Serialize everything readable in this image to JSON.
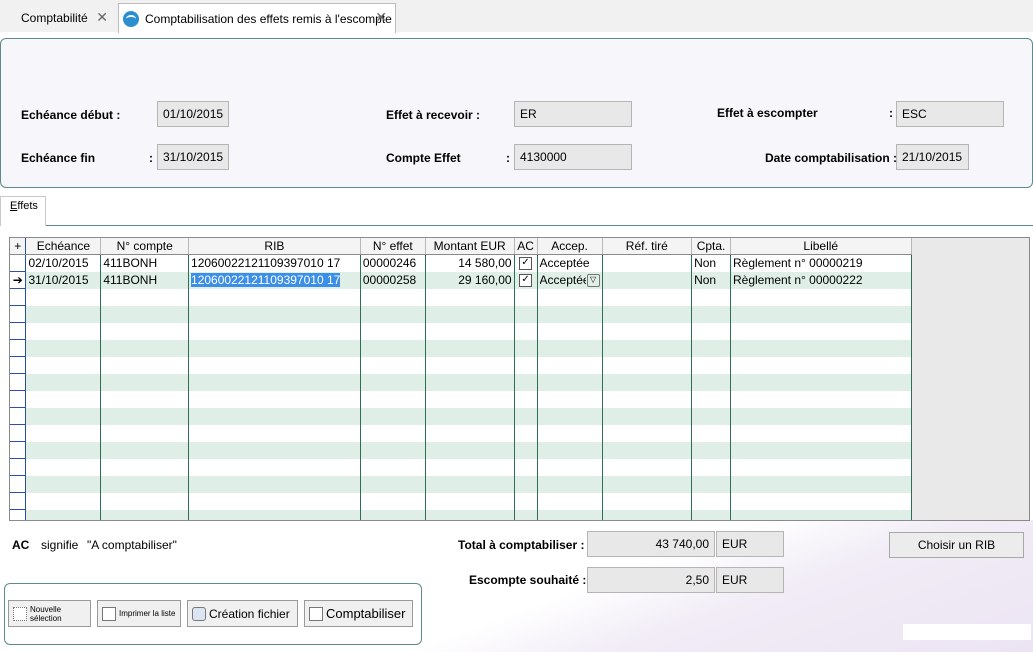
{
  "tabs": [
    {
      "label": "Comptabilité",
      "active": false
    },
    {
      "label": "Comptabilisation des effets remis à l'escompte",
      "active": true
    }
  ],
  "header": {
    "echeance_debut_label": "Echéance début :",
    "echeance_debut_value": "01/10/2015",
    "echeance_fin_label": "Echéance fin",
    "echeance_fin_value": "31/10/2015",
    "effet_recevoir_label": "Effet à recevoir :",
    "effet_recevoir_value": "ER",
    "compte_effet_label": "Compte Effet",
    "compte_effet_value": "4130000",
    "effet_escompter_label": "Effet à escompter",
    "effet_escompter_value": "ESC",
    "date_compta_label": "Date comptabilisation :",
    "date_compta_value": "21/10/2015",
    "colon": ":"
  },
  "subtab": {
    "label_first": "E",
    "label_rest": "ffets"
  },
  "grid": {
    "add_symbol": "+",
    "columns": [
      "Echéance",
      "N° compte",
      "RIB",
      "N° effet",
      "Montant EUR",
      "AC",
      "Accep.",
      "Réf. tiré",
      "Cpta.",
      "Libellé"
    ],
    "rows": [
      {
        "echeance": "02/10/2015",
        "compte": "411BONH",
        "rib": "12060022121109397010 17",
        "effet": "00000246",
        "montant": "14 580,00",
        "ac": "✓",
        "accep": "Acceptée",
        "ref": "",
        "cpta": "Non",
        "libelle": "Règlement n° 00000219",
        "marker": ""
      },
      {
        "echeance": "31/10/2015",
        "compte": "411BONH",
        "rib": "12060022121109397010 17",
        "effet": "00000258",
        "montant": "29 160,00",
        "ac": "✓",
        "accep": "Acceptée",
        "ref": "",
        "cpta": "Non",
        "libelle": "Règlement n° 00000222",
        "marker": "➔"
      }
    ]
  },
  "footer": {
    "ac_code": "AC",
    "ac_signifie": "signifie",
    "ac_meaning": "\"A comptabiliser\"",
    "total_label": "Total à comptabiliser :",
    "total_value": "43 740,00",
    "total_currency": "EUR",
    "escompte_label": "Escompte souhaité :",
    "escompte_value": "2,50",
    "escompte_currency": "EUR",
    "choisir_rib": "Choisir un RIB"
  },
  "actions": {
    "nouvelle_selection": "Nouvelle sélection",
    "imprimer": "Imprimer la liste",
    "creation_fichier": "Création fichier",
    "comptabiliser": "Comptabiliser"
  }
}
